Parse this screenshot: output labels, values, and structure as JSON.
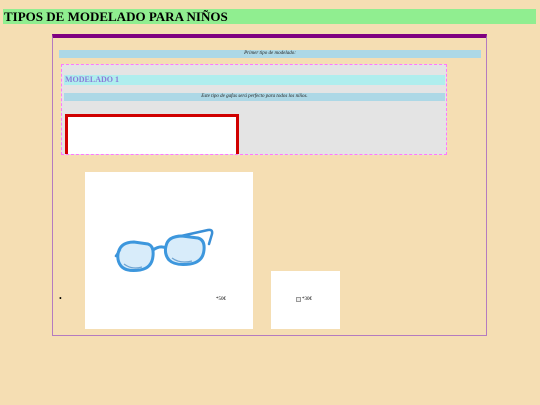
{
  "header": {
    "title": "TIPOS DE MODELADO PARA NIÑOS"
  },
  "intro": {
    "text": "Primer tipo de modelado:"
  },
  "model": {
    "title": "MODELADO 1",
    "description": "Este tipo de gafas será perfecto para todos los niños."
  },
  "products": [
    {
      "image": "blue-kids-glasses",
      "price": "*50€"
    },
    {
      "image_alt": "*30€"
    }
  ],
  "colors": {
    "background": "#f5deb3",
    "header": "#90ee90",
    "panel_top_border": "#800080",
    "bar": "#add8e6",
    "model_title_bg": "#afeeee",
    "model_title_text": "#8a7bd8",
    "video_border": "#d00000",
    "section_border": "#ff77ff"
  }
}
